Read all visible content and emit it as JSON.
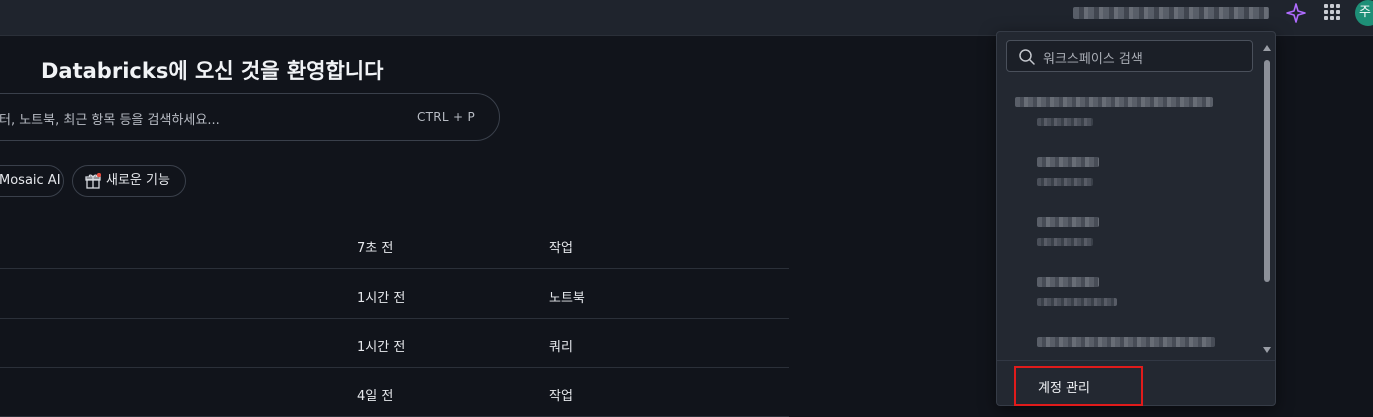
{
  "topbar": {
    "assistant_icon": "sparkle-icon",
    "apps_icon": "grid-apps-icon",
    "avatar_initial": "주",
    "avatar_color": "#1e8f77"
  },
  "main": {
    "welcome_title": "Databricks에 오신 것을 환영합니다",
    "search": {
      "placeholder": "터, 노트북, 최근 항목 등을 검색하세요...",
      "shortcut": "CTRL + P"
    },
    "chips": [
      {
        "label": "Mosaic AI"
      },
      {
        "label": "새로운 기능",
        "icon": "gift-icon"
      }
    ],
    "recent_rows": [
      {
        "time": "7초 전",
        "type": "작업"
      },
      {
        "time": "1시간 전",
        "type": "노트북"
      },
      {
        "time": "1시간 전",
        "type": "쿼리"
      },
      {
        "time": "4일 전",
        "type": "작업"
      }
    ]
  },
  "workspace_menu": {
    "search_placeholder": "워크스페이스 검색",
    "manage_account_label": "계정 관리",
    "highlight_color": "#e01b1b"
  }
}
